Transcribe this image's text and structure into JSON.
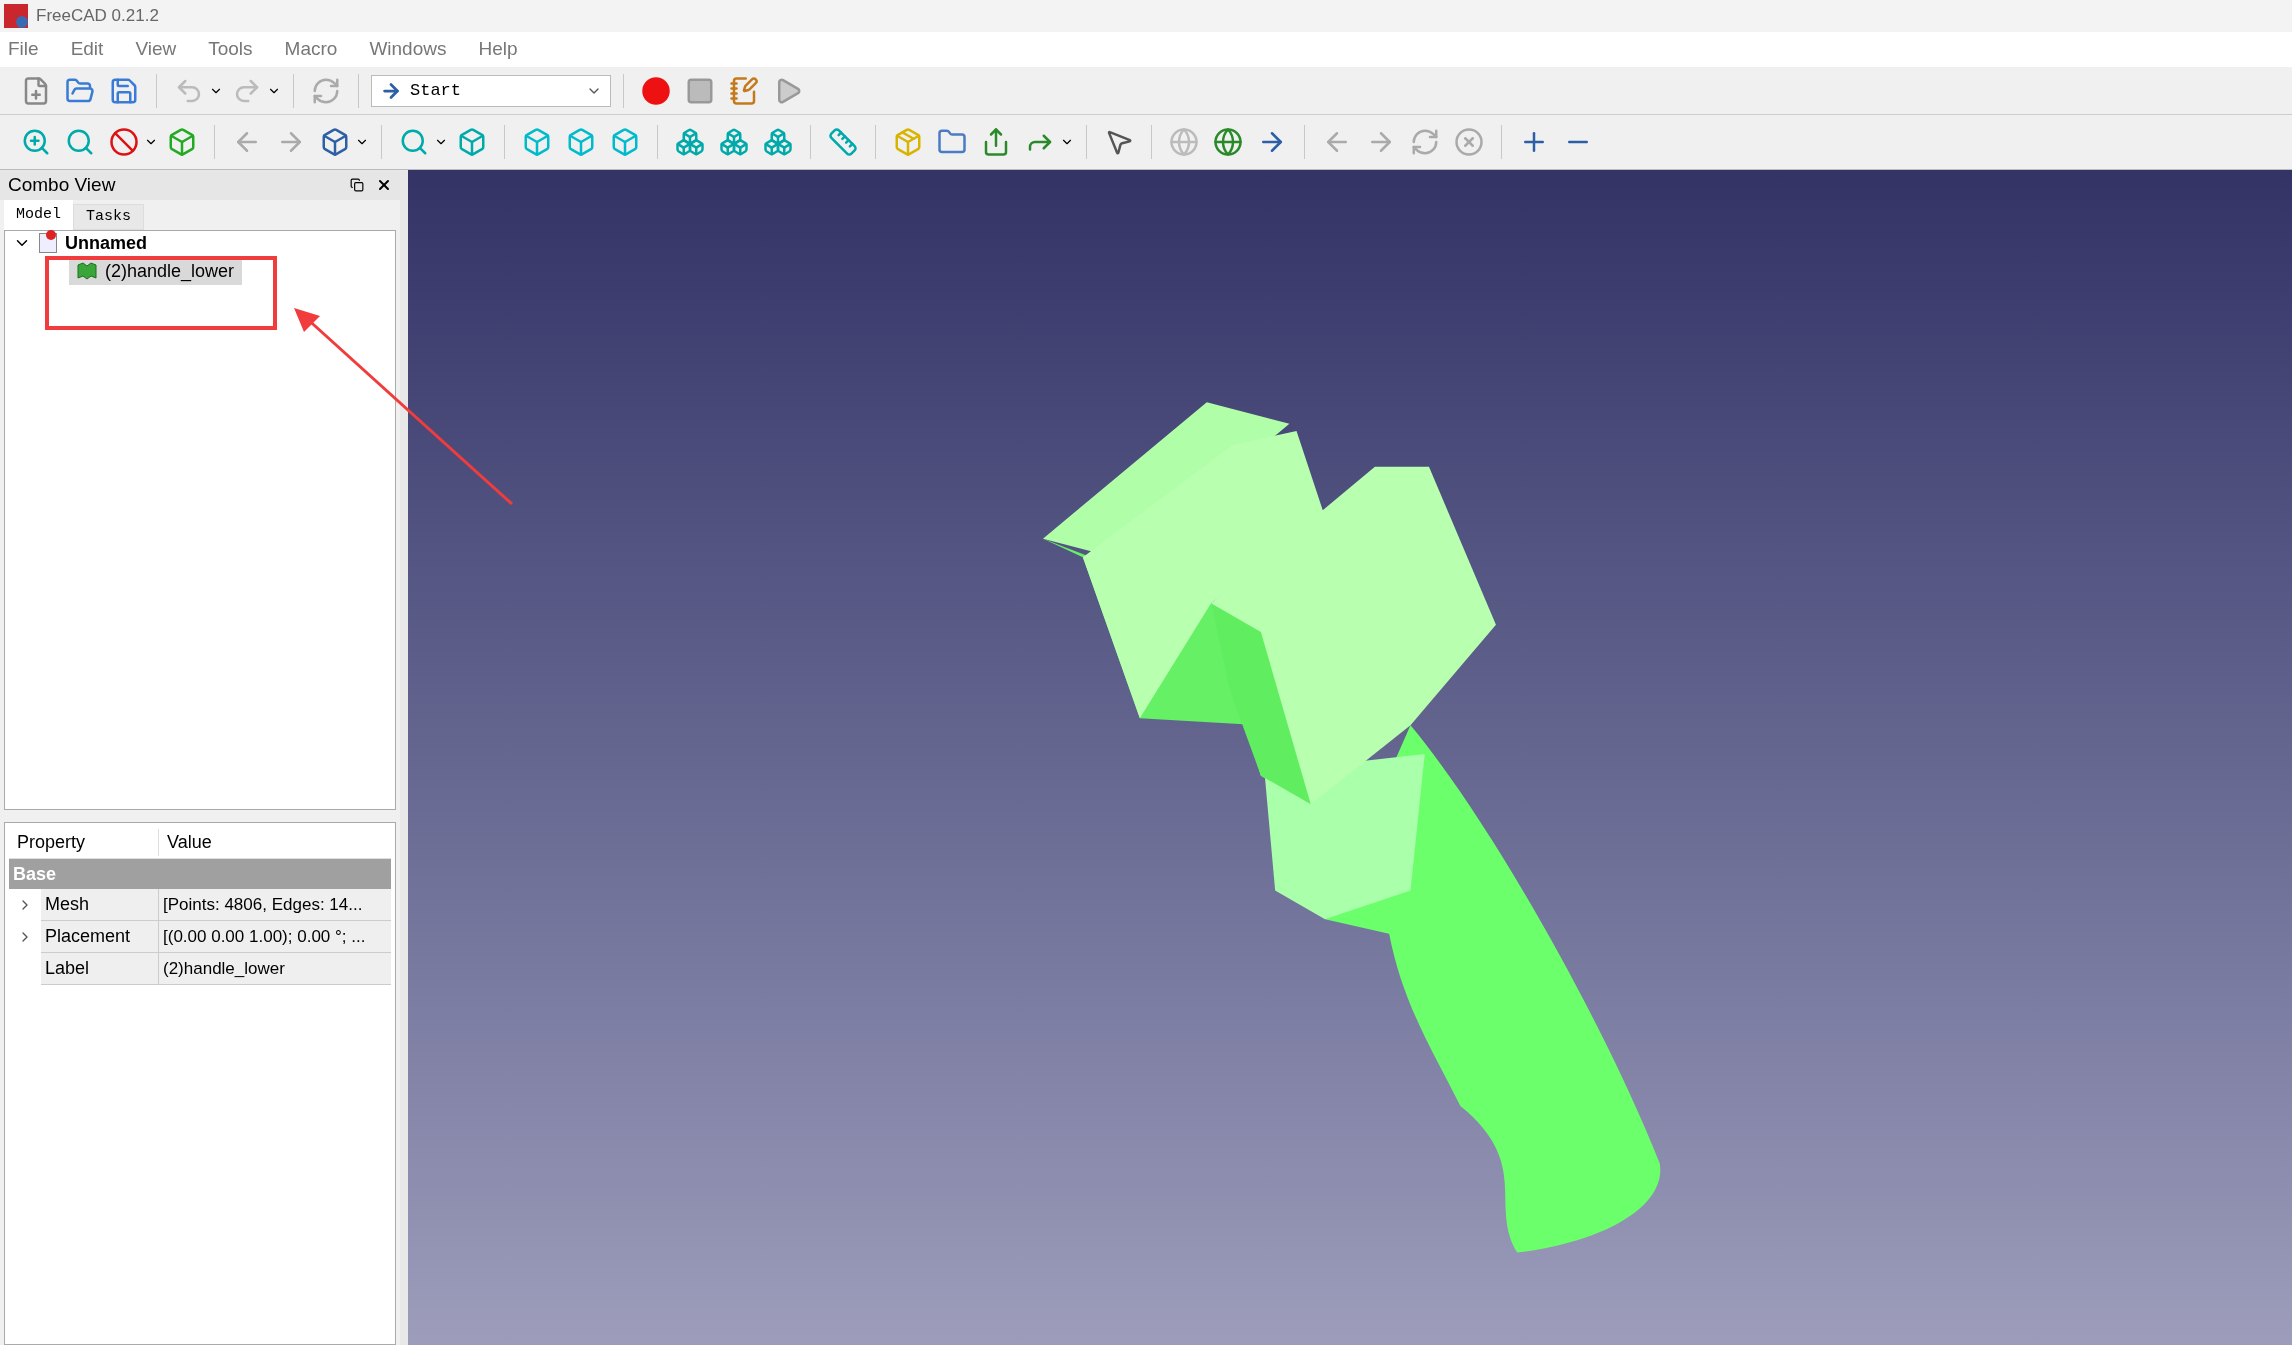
{
  "window": {
    "title": "FreeCAD 0.21.2"
  },
  "menu": [
    "File",
    "Edit",
    "View",
    "Tools",
    "Macro",
    "Windows",
    "Help"
  ],
  "workbench_selector": {
    "value": "Start"
  },
  "combo_view": {
    "title": "Combo View",
    "tabs": [
      {
        "label": "Model",
        "selected": true
      },
      {
        "label": "Tasks",
        "selected": false
      }
    ],
    "tree": [
      {
        "label": "Unnamed",
        "expanded": true,
        "children": [
          {
            "label": "(2)handle_lower",
            "selected": true
          }
        ]
      }
    ]
  },
  "property_table": {
    "columns": [
      "Property",
      "Value"
    ],
    "group": "Base",
    "rows": [
      {
        "name": "Mesh",
        "value": "[Points: 4806, Edges: 14...",
        "expandable": true
      },
      {
        "name": "Placement",
        "value": "[(0.00 0.00 1.00); 0.00 °; ...",
        "expandable": true
      },
      {
        "name": "Label",
        "value": "(2)handle_lower",
        "expandable": false
      }
    ]
  }
}
